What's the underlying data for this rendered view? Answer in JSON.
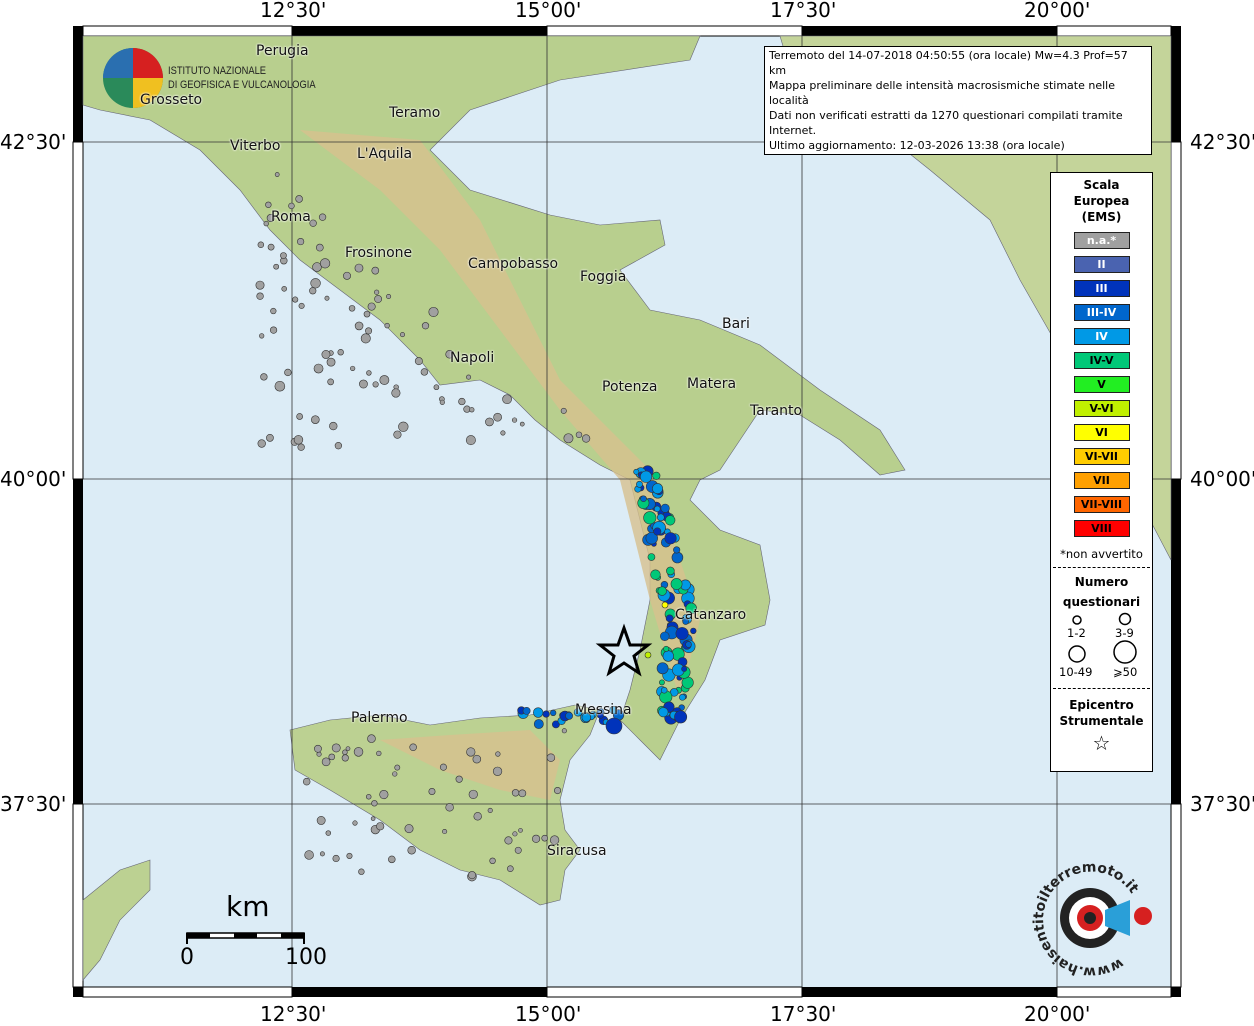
{
  "axes": {
    "lon_ticks": [
      "12°30'",
      "15°00'",
      "17°30'",
      "20°00'"
    ],
    "lat_ticks": [
      "42°30'",
      "40°00'",
      "37°30'"
    ]
  },
  "info_box": {
    "line1": "Terremoto del 14-07-2018 04:50:55 (ora locale) Mw=4.3 Prof=57 km",
    "line2": "Mappa preliminare delle intensità macrosismiche stimate nelle località",
    "line3": "Dati non verificati estratti da 1270 questionari compilati tramite Internet.",
    "line4": "Ultimo aggiornamento: 12-03-2026 13:38 (ora locale)"
  },
  "logo": {
    "line1": "ISTITUTO NAZIONALE",
    "line2": "DI GEOFISICA E VULCANOLOGIA"
  },
  "legend": {
    "title": [
      "Scala",
      "Europea",
      "(EMS)"
    ],
    "classes": [
      {
        "label": "n.a.*",
        "color": "#a0a0a0",
        "text": "#fff"
      },
      {
        "label": "II",
        "color": "#4a63b0",
        "text": "#fff"
      },
      {
        "label": "III",
        "color": "#0033bb",
        "text": "#fff"
      },
      {
        "label": "III-IV",
        "color": "#0066cc",
        "text": "#fff"
      },
      {
        "label": "IV",
        "color": "#0099e6",
        "text": "#fff"
      },
      {
        "label": "IV-V",
        "color": "#00c878",
        "text": "#000"
      },
      {
        "label": "V",
        "color": "#22ee22",
        "text": "#000"
      },
      {
        "label": "V-VI",
        "color": "#c0f000",
        "text": "#000"
      },
      {
        "label": "VI",
        "color": "#ffff00",
        "text": "#000"
      },
      {
        "label": "VI-VII",
        "color": "#ffcc00",
        "text": "#000"
      },
      {
        "label": "VII",
        "color": "#ffa000",
        "text": "#000"
      },
      {
        "label": "VII-VIII",
        "color": "#ff6600",
        "text": "#000"
      },
      {
        "label": "VIII",
        "color": "#ff0000",
        "text": "#000"
      }
    ],
    "note": "*non avvertito",
    "count_title": [
      "Numero",
      "questionari"
    ],
    "counts": [
      "1-2",
      "3-9",
      "10-49",
      "⩾50"
    ],
    "epicenter_title": [
      "Epicentro",
      "Strumentale"
    ]
  },
  "cities": [
    {
      "name": "Perugia"
    },
    {
      "name": "Grosseto"
    },
    {
      "name": "Teramo"
    },
    {
      "name": "Viterbo"
    },
    {
      "name": "L'Aquila"
    },
    {
      "name": "Roma"
    },
    {
      "name": "Frosinone"
    },
    {
      "name": "Campobasso"
    },
    {
      "name": "Foggia"
    },
    {
      "name": "Bari"
    },
    {
      "name": "Napoli"
    },
    {
      "name": "Potenza"
    },
    {
      "name": "Matera"
    },
    {
      "name": "Taranto"
    },
    {
      "name": "Catanzaro"
    },
    {
      "name": "Messina"
    },
    {
      "name": "Palermo"
    },
    {
      "name": "Siracusa"
    }
  ],
  "scale_bar": {
    "unit": "km",
    "min": "0",
    "max": "100"
  },
  "hsit_logo": "www.haisentitoilterremoto.it"
}
